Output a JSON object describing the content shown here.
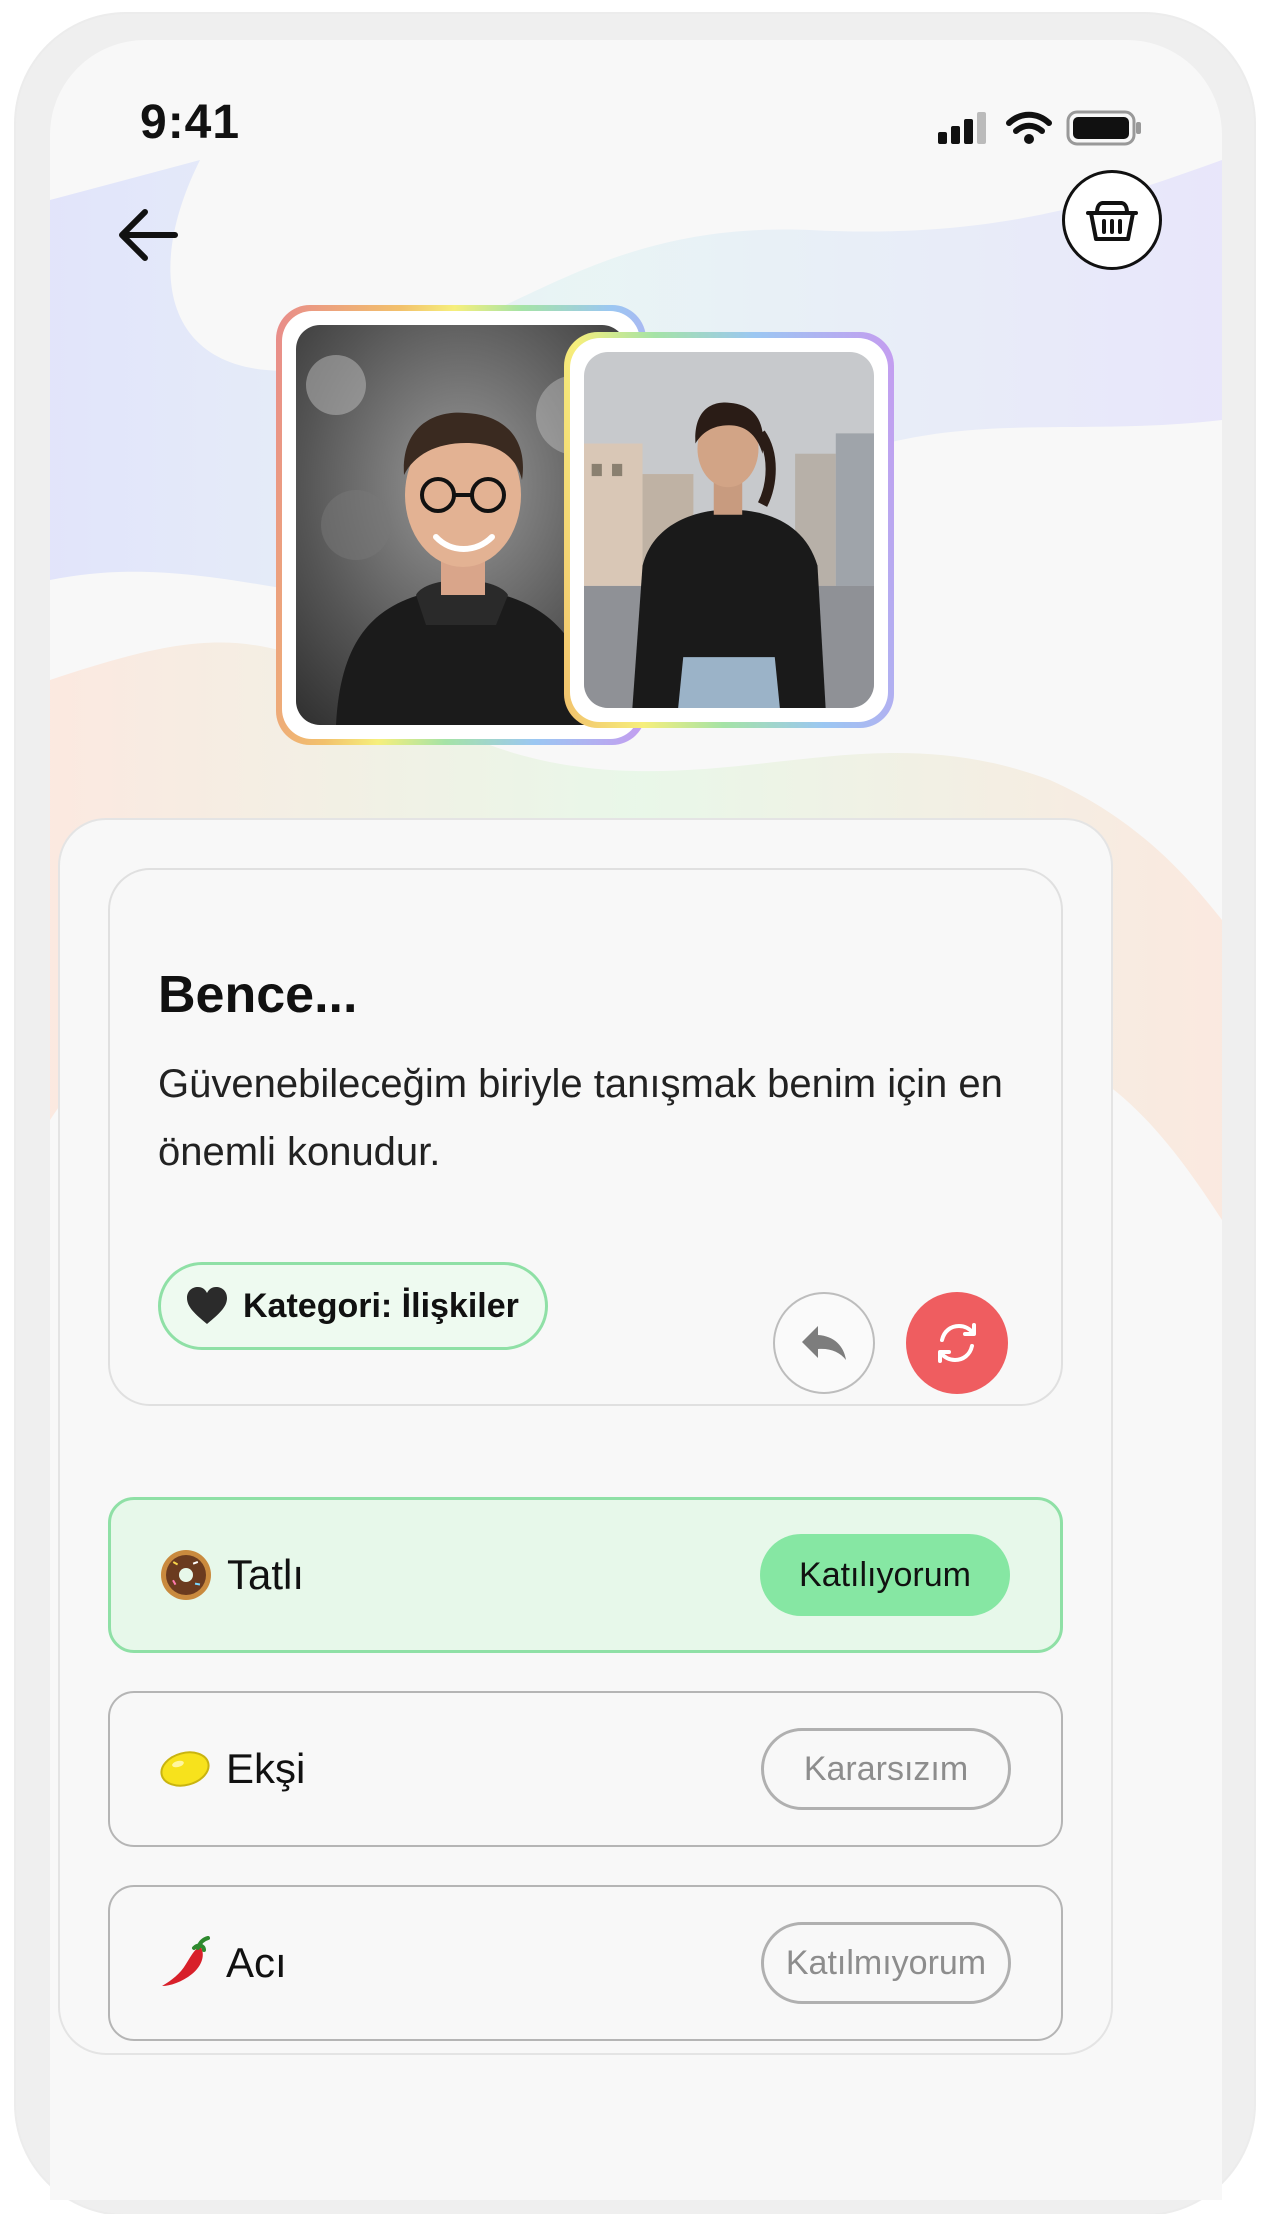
{
  "status_bar": {
    "time": "9:41"
  },
  "header": {
    "back_icon": "arrow-left-icon",
    "basket_icon": "basket-icon"
  },
  "statement": {
    "title": "Bence...",
    "text": "Güvenebileceğim biriyle tanışmak benim için en önemli konudur."
  },
  "category": {
    "icon": "heart-icon",
    "label": "Kategori: İlişkiler"
  },
  "options": [
    {
      "icon": "donut-icon",
      "label": "Tatlı",
      "tag": "Katılıyorum"
    },
    {
      "icon": "lemon-icon",
      "label": "Ekşi",
      "tag": "Kararsızım"
    },
    {
      "icon": "chili-pepper-icon",
      "label": "Acı",
      "tag": "Katılmıyorum"
    }
  ],
  "colors": {
    "accent_green": "#86e7a3",
    "refresh_red": "#ef5d60",
    "border_grey": "#b5b5b5"
  }
}
